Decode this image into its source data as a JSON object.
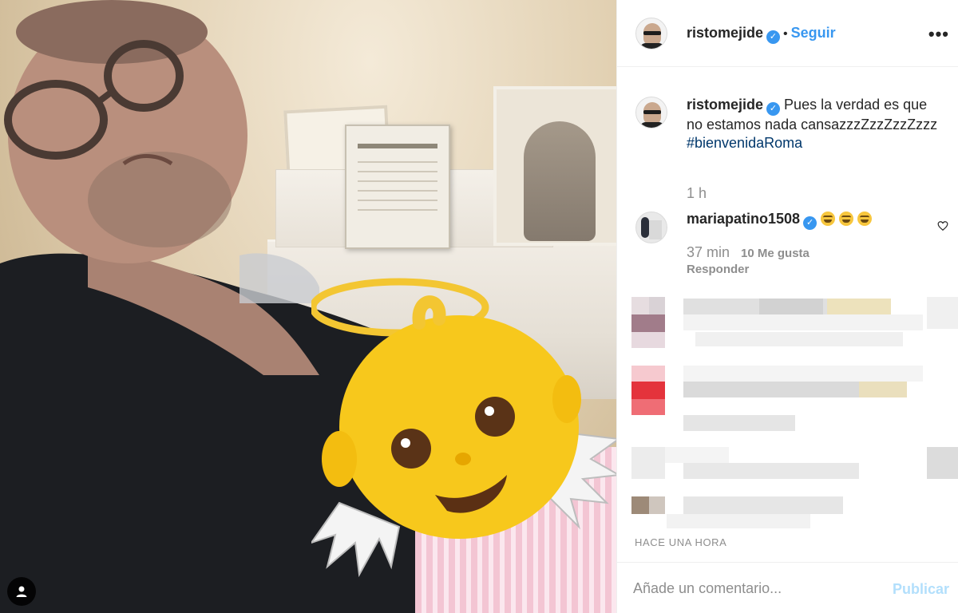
{
  "post": {
    "author": "ristomejide",
    "verified": true,
    "follow_label": "Seguir",
    "separator": "•",
    "more_label": "•••"
  },
  "caption": {
    "author": "ristomejide",
    "text": "Pues la verdad es que no estamos nada cansazzzZzzZzzZzzz",
    "hashtag": "#bienvenidaRoma",
    "time": "1 h"
  },
  "comments": [
    {
      "author": "mariapatino1508",
      "verified": true,
      "emoji": [
        "laughing-emoji",
        "laughing-emoji",
        "laughing-emoji"
      ],
      "time": "37 min",
      "likes": "10 Me gusta",
      "reply_label": "Responder"
    }
  ],
  "timestamp": "HACE UNA HORA",
  "composer": {
    "placeholder": "Añade un comentario...",
    "publish_label": "Publicar"
  },
  "colors": {
    "accent": "#3897f0",
    "hashtag": "#00376b",
    "muted": "#8e8e8e",
    "publish_disabled": "#b2dffc"
  }
}
